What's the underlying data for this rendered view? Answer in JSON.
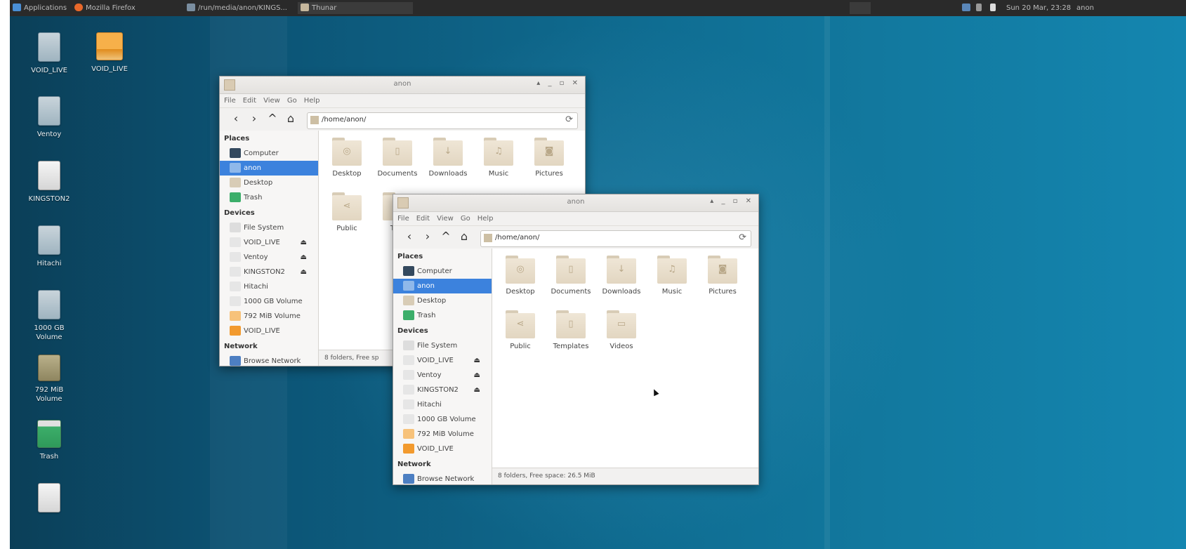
{
  "panel": {
    "applications": "Applications",
    "tasks": [
      "Mozilla Firefox",
      "/run/media/anon/KINGS...",
      "Thunar"
    ],
    "clock": "Sun 20 Mar, 23:28",
    "user": "anon"
  },
  "desktop_icons": [
    {
      "label": "VOID_LIVE",
      "icon": "drive-icon"
    },
    {
      "label": "VOID_LIVE",
      "icon": "orange-drive-icon"
    },
    {
      "label": "Ventoy",
      "icon": "drive-icon"
    },
    {
      "label": "KINGSTON2",
      "icon": "drive-icon"
    },
    {
      "label": "Hitachi",
      "icon": "drive-icon"
    },
    {
      "label": "1000 GB Volume",
      "icon": "drive-icon"
    },
    {
      "label": "792 MiB Volume",
      "icon": "drive-icon"
    },
    {
      "label": "Trash",
      "icon": "trash-icon"
    },
    {
      "label": "",
      "icon": "drive-icon"
    }
  ],
  "window_back": {
    "title": "anon",
    "menu": [
      "File",
      "Edit",
      "View",
      "Go",
      "Help"
    ],
    "path": "/home/anon/",
    "sections": {
      "places": "Places",
      "devices": "Devices",
      "network": "Network"
    },
    "places": [
      "Computer",
      "anon",
      "Desktop",
      "Trash"
    ],
    "devices": [
      "File System",
      "VOID_LIVE",
      "Ventoy",
      "KINGSTON2",
      "Hitachi",
      "1000 GB Volume",
      "792 MiB Volume",
      "VOID_LIVE"
    ],
    "network": [
      "Browse Network"
    ],
    "folders": [
      "Desktop",
      "Documents",
      "Downloads",
      "Music",
      "Pictures",
      "Public",
      "Tem"
    ],
    "status": "8 folders, Free sp"
  },
  "window_front": {
    "title": "anon",
    "menu": [
      "File",
      "Edit",
      "View",
      "Go",
      "Help"
    ],
    "path": "/home/anon/",
    "sections": {
      "places": "Places",
      "devices": "Devices",
      "network": "Network"
    },
    "places": [
      "Computer",
      "anon",
      "Desktop",
      "Trash"
    ],
    "devices": [
      "File System",
      "VOID_LIVE",
      "Ventoy",
      "KINGSTON2",
      "Hitachi",
      "1000 GB Volume",
      "792 MiB Volume",
      "VOID_LIVE"
    ],
    "network": [
      "Browse Network"
    ],
    "folders": [
      "Desktop",
      "Documents",
      "Downloads",
      "Music",
      "Pictures",
      "Public",
      "Templates",
      "Videos"
    ],
    "status": "8 folders, Free space: 26.5 MiB"
  },
  "colors": {
    "selection": "#3c82dd",
    "panel": "#2a2a2a",
    "desktop": "#0f6d92"
  }
}
